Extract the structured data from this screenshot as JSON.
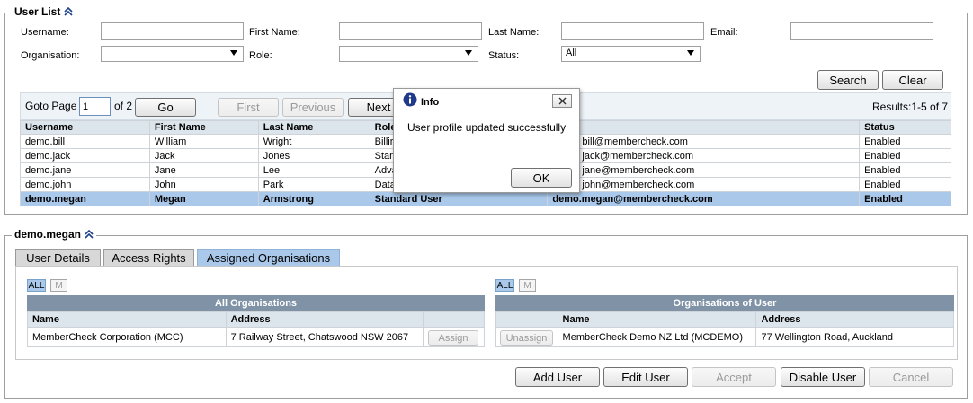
{
  "user_list": {
    "title": "User List",
    "filters": {
      "username_label": "Username:",
      "first_name_label": "First Name:",
      "last_name_label": "Last Name:",
      "email_label": "Email:",
      "organisation_label": "Organisation:",
      "role_label": "Role:",
      "status_label": "Status:",
      "username_value": "",
      "first_name_value": "",
      "last_name_value": "",
      "email_value": "",
      "organisation_value": "",
      "role_value": "",
      "status_value": "All"
    },
    "search_label": "Search",
    "clear_label": "Clear",
    "pager": {
      "goto_label": "Goto Page",
      "page_value": "1",
      "of_label": "of 2",
      "go_label": "Go",
      "first_label": "First",
      "previous_label": "Previous",
      "next_label": "Next",
      "results": "Results:1-5 of 7"
    },
    "columns": [
      "Username",
      "First Name",
      "Last Name",
      "Role",
      "",
      "Status"
    ],
    "rows": [
      {
        "username": "demo.bill",
        "first": "William",
        "last": "Wright",
        "role": "Billir",
        "email": "bill@membercheck.com",
        "status": "Enabled"
      },
      {
        "username": "demo.jack",
        "first": "Jack",
        "last": "Jones",
        "role": "Stan",
        "email": "jack@membercheck.com",
        "status": "Enabled"
      },
      {
        "username": "demo.jane",
        "first": "Jane",
        "last": "Lee",
        "role": "Adva",
        "email": "jane@membercheck.com",
        "status": "Enabled"
      },
      {
        "username": "demo.john",
        "first": "John",
        "last": "Park",
        "role": "Data",
        "email": "john@membercheck.com",
        "status": "Enabled"
      },
      {
        "username": "demo.megan",
        "first": "Megan",
        "last": "Armstrong",
        "role": "Standard User",
        "email": "demo.megan@membercheck.com",
        "status": "Enabled"
      }
    ]
  },
  "detail": {
    "title": "demo.megan",
    "tabs": [
      "User Details",
      "Access Rights",
      "Assigned Organisations"
    ],
    "left": {
      "all_label": "ALL",
      "m_label": "M",
      "header": "All Organisations",
      "columns": [
        "Name",
        "Address"
      ],
      "rows": [
        {
          "name": "MemberCheck Corporation (MCC)",
          "address": "7 Railway Street, Chatswood NSW 2067",
          "action": "Assign"
        }
      ]
    },
    "right": {
      "all_label": "ALL",
      "m_label": "M",
      "header": "Organisations of User",
      "columns": [
        "Name",
        "Address"
      ],
      "rows": [
        {
          "action": "Unassign",
          "name": "MemberCheck Demo NZ Ltd (MCDEMO)",
          "address": "77 Wellington Road, Auckland"
        }
      ]
    },
    "buttons": {
      "add": "Add User",
      "edit": "Edit User",
      "accept": "Accept",
      "disable": "Disable User",
      "cancel": "Cancel"
    }
  },
  "dialog": {
    "title": "Info",
    "message": "User profile updated successfully",
    "ok_label": "OK"
  }
}
